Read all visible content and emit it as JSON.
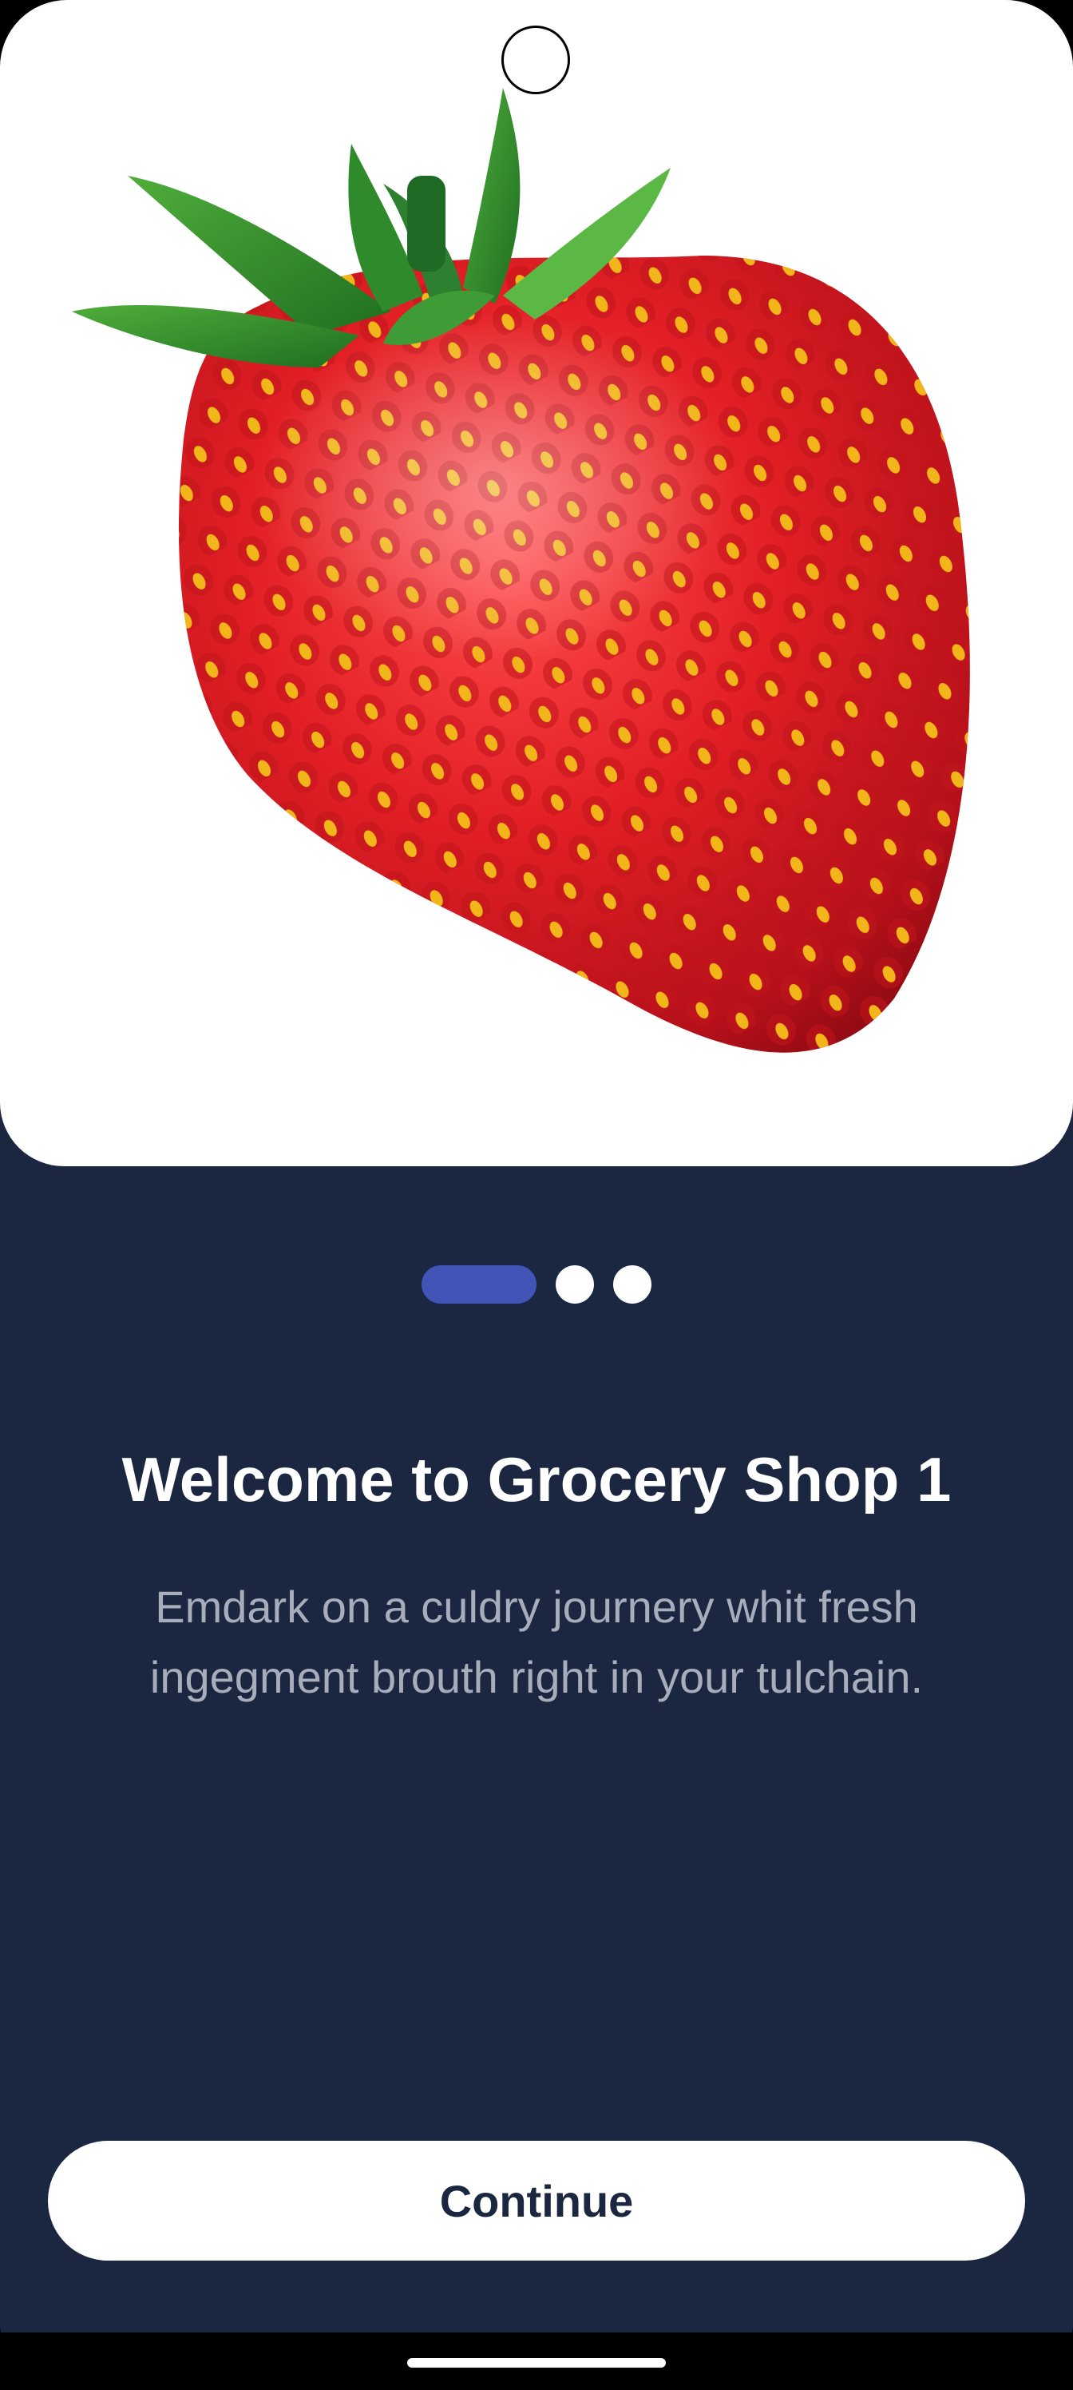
{
  "onboarding": {
    "title": "Welcome to Grocery Shop 1",
    "description": "Emdark on a culdry journery whit fresh ingegment brouth right in your tulchain.",
    "continue_label": "Continue",
    "pager": {
      "total_pages": 3,
      "current_page": 1
    },
    "hero_image": "strawberry-image"
  },
  "colors": {
    "background": "#1b2640",
    "hero_background": "#ffffff",
    "indicator_active": "#4254b8",
    "indicator_inactive": "#ffffff",
    "title": "#ffffff",
    "description": "#a7adba",
    "button_background": "#ffffff",
    "button_text": "#1b2640"
  }
}
